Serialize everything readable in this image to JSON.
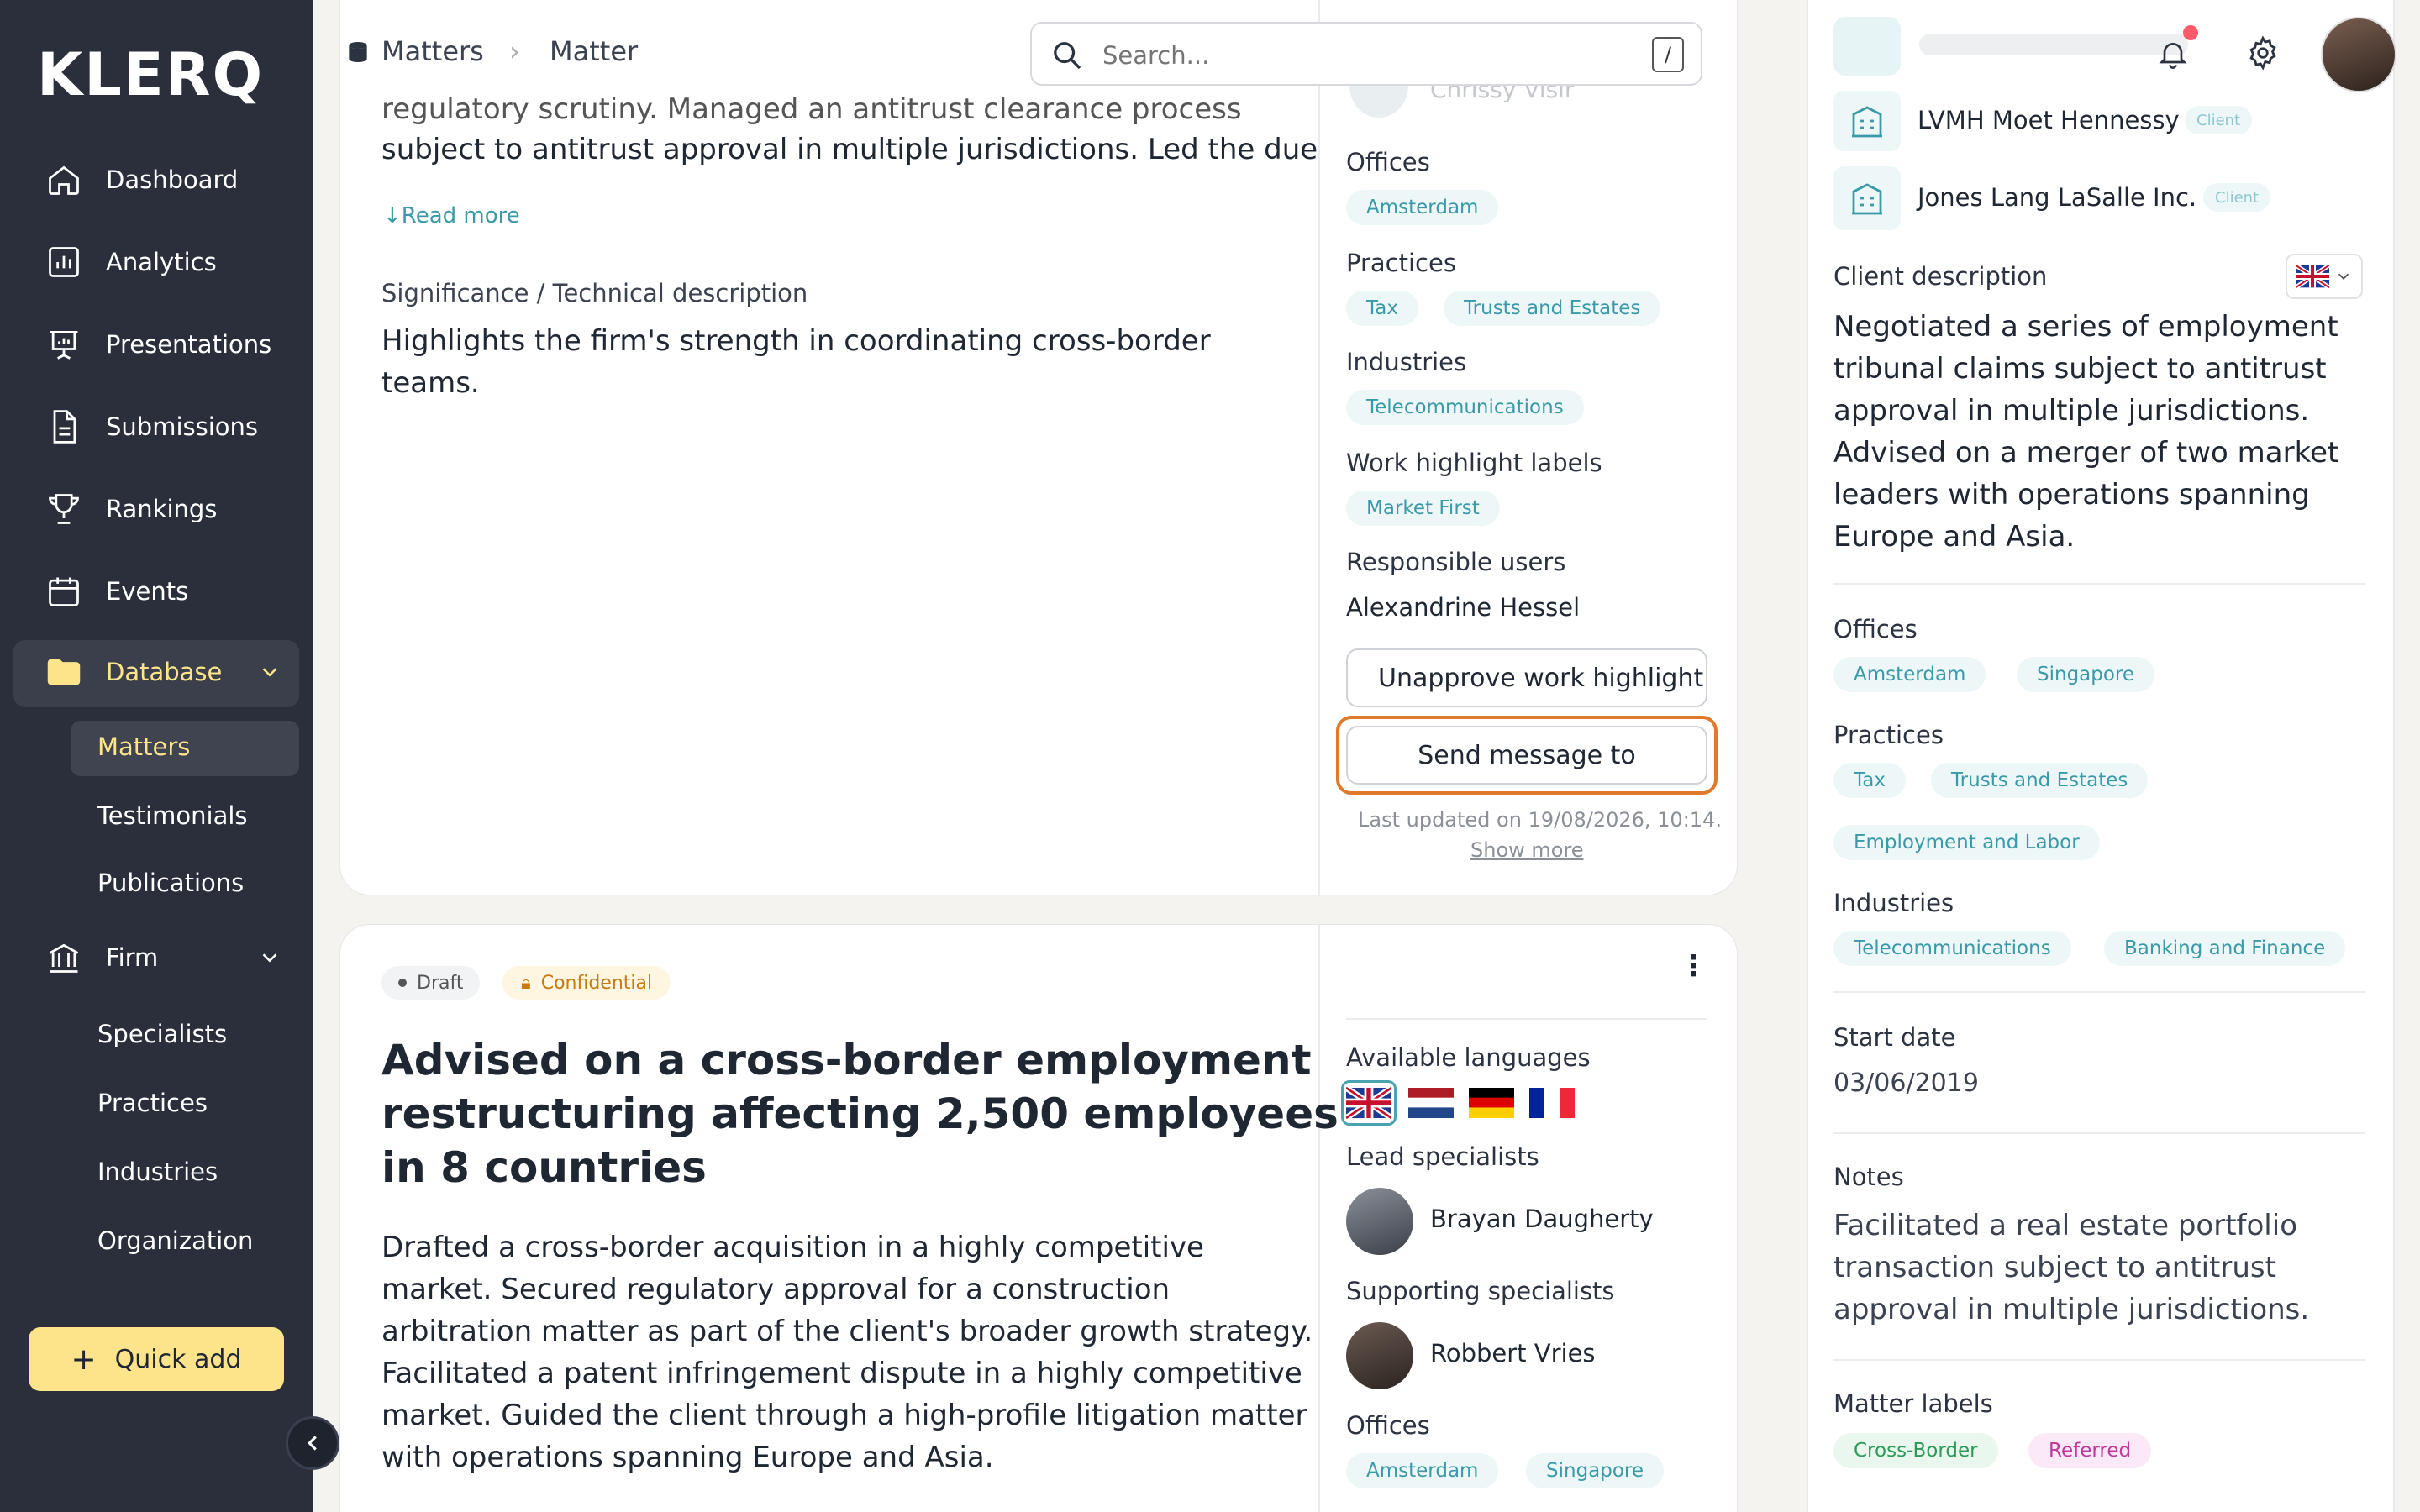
{
  "brand": {
    "logo": "KLERQ"
  },
  "nav": {
    "dashboard": "Dashboard",
    "analytics": "Analytics",
    "presentations": "Presentations",
    "submissions": "Submissions",
    "rankings": "Rankings",
    "events": "Events",
    "database": "Database",
    "matters": "Matters",
    "testimonials": "Testimonials",
    "publications": "Publications",
    "firm": "Firm",
    "specialists": "Specialists",
    "practices": "Practices",
    "industries": "Industries",
    "organization": "Organization",
    "quick_add": "Quick add"
  },
  "breadcrumb": {
    "root": "Matters",
    "current": "Matter"
  },
  "search": {
    "placeholder": "Search...",
    "shortcut": "/"
  },
  "card1": {
    "desc_line1": "regulatory scrutiny. Managed an antitrust clearance process",
    "desc_line2": "subject to antitrust approval in multiple jurisdictions. Led the due",
    "read_more": "Read more",
    "significance_label": "Significance / Technical description",
    "significance_l1": "Highlights the firm's strength in coordinating cross-border",
    "significance_l2": "teams.",
    "side": {
      "faded_name": "Chrissy Visir",
      "offices_label": "Offices",
      "offices": [
        "Amsterdam"
      ],
      "practices_label": "Practices",
      "practices": [
        "Tax",
        "Trusts and Estates"
      ],
      "industries_label": "Industries",
      "industries": [
        "Telecommunications"
      ],
      "whl_label": "Work highlight labels",
      "whl": [
        "Market First"
      ],
      "resp_label": "Responsible users",
      "resp_user": "Alexandrine Hessel",
      "unapprove": "Unapprove work highlight",
      "send_message": "Send message to",
      "last_updated": "Last updated on 19/08/2026, 10:14.",
      "show_more": "Show more"
    }
  },
  "card2": {
    "status": "Draft",
    "confidential": "Confidential",
    "title_l1": "Advised on a cross-border employment",
    "title_l2": "restructuring affecting 2,500 employees",
    "title_l3": "in 8 countries",
    "body": [
      "Drafted a cross-border acquisition in a highly competitive",
      "market. Secured regulatory approval for a construction",
      "arbitration matter as part of the client's broader growth strategy.",
      "Facilitated a patent infringement dispute in a highly competitive",
      "market. Guided the client through a high-profile litigation matter",
      "with operations spanning Europe and Asia."
    ],
    "side": {
      "langs_label": "Available languages",
      "lead_label": "Lead specialists",
      "lead": "Brayan Daugherty",
      "support_label": "Supporting specialists",
      "support": "Robbert Vries",
      "offices_label": "Offices",
      "offices": [
        "Amsterdam",
        "Singapore"
      ]
    }
  },
  "right": {
    "clients": [
      {
        "name": "LVMH Moet Hennessy",
        "tag": "Client"
      },
      {
        "name": "Jones Lang LaSalle Inc.",
        "tag": "Client"
      }
    ],
    "client_desc_label": "Client description",
    "client_desc": [
      "Negotiated a series of employment",
      "tribunal claims subject to antitrust",
      "approval in multiple jurisdictions.",
      "Advised on a merger of two market",
      "leaders with operations spanning",
      "Europe and Asia."
    ],
    "offices_label": "Offices",
    "offices": [
      "Amsterdam",
      "Singapore"
    ],
    "practices_label": "Practices",
    "practices": [
      "Tax",
      "Trusts and Estates",
      "Employment and Labor"
    ],
    "industries_label": "Industries",
    "industries": [
      "Telecommunications",
      "Banking and Finance"
    ],
    "start_label": "Start date",
    "start": "03/06/2019",
    "notes_label": "Notes",
    "notes": [
      "Facilitated a real estate portfolio",
      "transaction subject to antitrust",
      "approval in multiple jurisdictions."
    ],
    "labels_label": "Matter labels",
    "labels": [
      "Cross-Border",
      "Referred"
    ]
  },
  "colors": {
    "sidebar": "#2a2f3b",
    "accent": "#fde48b",
    "chip_text": "#3a9aa7",
    "focus": "#e07a2a"
  }
}
